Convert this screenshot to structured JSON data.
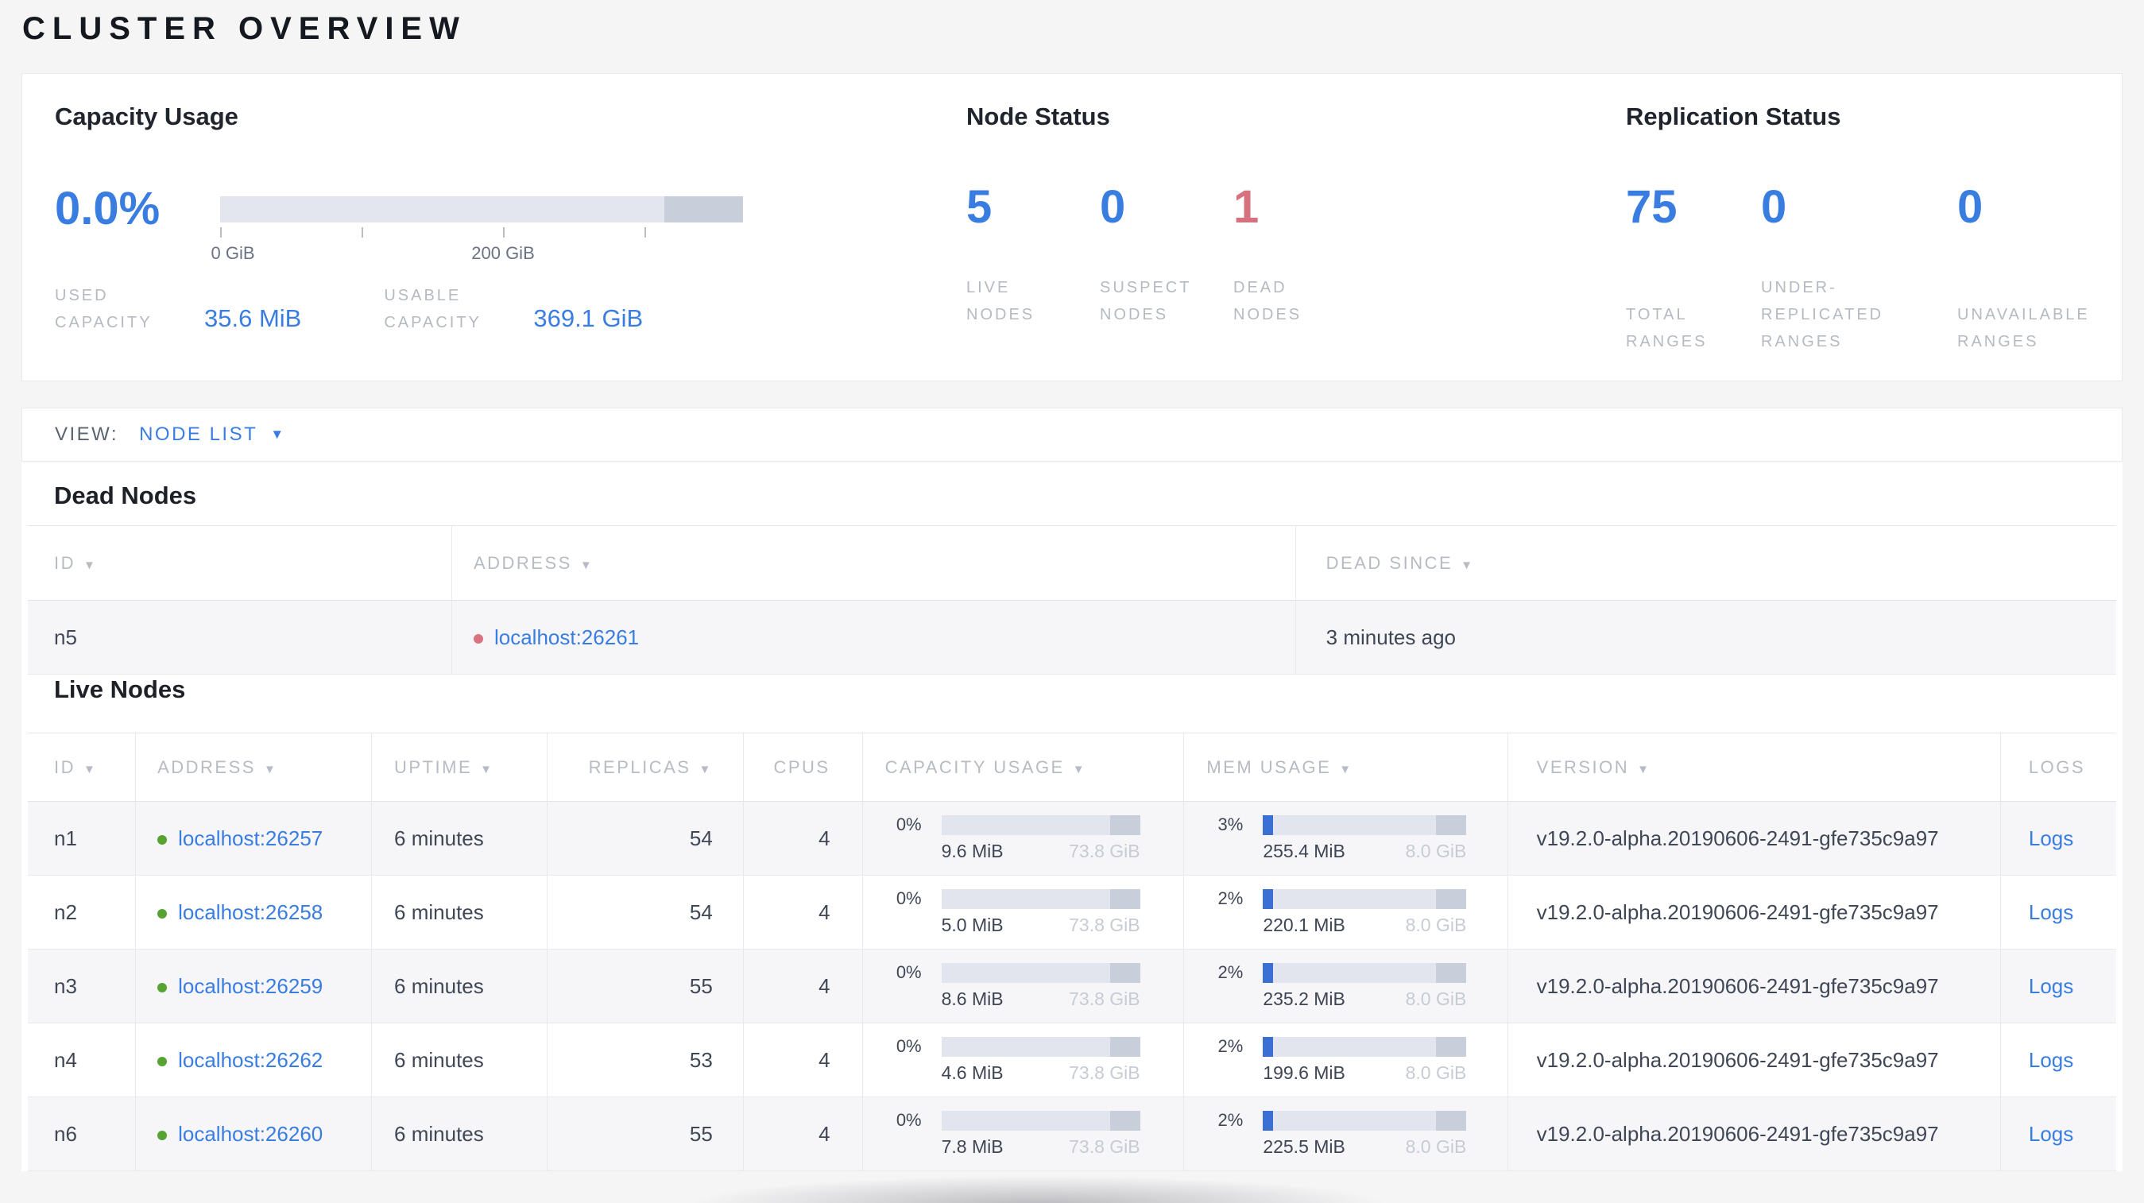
{
  "page": {
    "title": "CLUSTER OVERVIEW"
  },
  "icons": {
    "sort_desc": "▼",
    "dropdown_caret": "▼"
  },
  "colors": {
    "accent_blue": "#3a7de1",
    "dead_red": "#d7707f",
    "live_green": "#56a331",
    "bar_track": "#e3e5ee",
    "bar_reserved": "#c9cfda",
    "label_gray": "#b5bac2"
  },
  "summary": {
    "capacity": {
      "heading": "Capacity Usage",
      "percent": "0.0%",
      "tick_labels": [
        "0 GiB",
        "200 GiB"
      ],
      "used_label": "USED CAPACITY",
      "used_value": "35.6 MiB",
      "usable_label": "USABLE CAPACITY",
      "usable_value": "369.1 GiB"
    },
    "node_status": {
      "heading": "Node Status",
      "stats": [
        {
          "value": "5",
          "label": "LIVE NODES"
        },
        {
          "value": "0",
          "label": "SUSPECT NODES"
        },
        {
          "value": "1",
          "label": "DEAD NODES"
        }
      ]
    },
    "replication": {
      "heading": "Replication Status",
      "stats": [
        {
          "value": "75",
          "label": "TOTAL RANGES"
        },
        {
          "value": "0",
          "label": "UNDER-REPLICATED RANGES"
        },
        {
          "value": "0",
          "label": "UNAVAILABLE RANGES"
        }
      ]
    }
  },
  "view_bar": {
    "label": "VIEW:",
    "selected": "NODE LIST"
  },
  "dead_nodes": {
    "heading": "Dead Nodes",
    "columns": [
      {
        "label": "ID",
        "sortable": true
      },
      {
        "label": "ADDRESS",
        "sortable": true
      },
      {
        "label": "DEAD SINCE",
        "sortable": true
      }
    ],
    "rows": [
      {
        "id": "n5",
        "address": "localhost:26261",
        "dead_since": "3 minutes ago"
      }
    ]
  },
  "live_nodes": {
    "heading": "Live Nodes",
    "columns": [
      {
        "label": "ID",
        "sortable": true
      },
      {
        "label": "ADDRESS",
        "sortable": true
      },
      {
        "label": "UPTIME",
        "sortable": true
      },
      {
        "label": "REPLICAS",
        "sortable": true
      },
      {
        "label": "CPUS",
        "sortable": false
      },
      {
        "label": "CAPACITY USAGE",
        "sortable": true
      },
      {
        "label": "MEM USAGE",
        "sortable": true
      },
      {
        "label": "VERSION",
        "sortable": true
      },
      {
        "label": "LOGS",
        "sortable": false
      }
    ],
    "rows": [
      {
        "id": "n1",
        "address": "localhost:26257",
        "uptime": "6 minutes",
        "replicas": "54",
        "cpus": "4",
        "cap_pct": "0%",
        "cap_used": "9.6 MiB",
        "cap_total": "73.8 GiB",
        "mem_pct": "3%",
        "mem_used": "255.4 MiB",
        "mem_total": "8.0 GiB",
        "version": "v19.2.0-alpha.20190606-2491-gfe735c9a97",
        "logs": "Logs"
      },
      {
        "id": "n2",
        "address": "localhost:26258",
        "uptime": "6 minutes",
        "replicas": "54",
        "cpus": "4",
        "cap_pct": "0%",
        "cap_used": "5.0 MiB",
        "cap_total": "73.8 GiB",
        "mem_pct": "2%",
        "mem_used": "220.1 MiB",
        "mem_total": "8.0 GiB",
        "version": "v19.2.0-alpha.20190606-2491-gfe735c9a97",
        "logs": "Logs"
      },
      {
        "id": "n3",
        "address": "localhost:26259",
        "uptime": "6 minutes",
        "replicas": "55",
        "cpus": "4",
        "cap_pct": "0%",
        "cap_used": "8.6 MiB",
        "cap_total": "73.8 GiB",
        "mem_pct": "2%",
        "mem_used": "235.2 MiB",
        "mem_total": "8.0 GiB",
        "version": "v19.2.0-alpha.20190606-2491-gfe735c9a97",
        "logs": "Logs"
      },
      {
        "id": "n4",
        "address": "localhost:26262",
        "uptime": "6 minutes",
        "replicas": "53",
        "cpus": "4",
        "cap_pct": "0%",
        "cap_used": "4.6 MiB",
        "cap_total": "73.8 GiB",
        "mem_pct": "2%",
        "mem_used": "199.6 MiB",
        "mem_total": "8.0 GiB",
        "version": "v19.2.0-alpha.20190606-2491-gfe735c9a97",
        "logs": "Logs"
      },
      {
        "id": "n6",
        "address": "localhost:26260",
        "uptime": "6 minutes",
        "replicas": "55",
        "cpus": "4",
        "cap_pct": "0%",
        "cap_used": "7.8 MiB",
        "cap_total": "73.8 GiB",
        "mem_pct": "2%",
        "mem_used": "225.5 MiB",
        "mem_total": "8.0 GiB",
        "version": "v19.2.0-alpha.20190606-2491-gfe735c9a97",
        "logs": "Logs"
      }
    ]
  }
}
